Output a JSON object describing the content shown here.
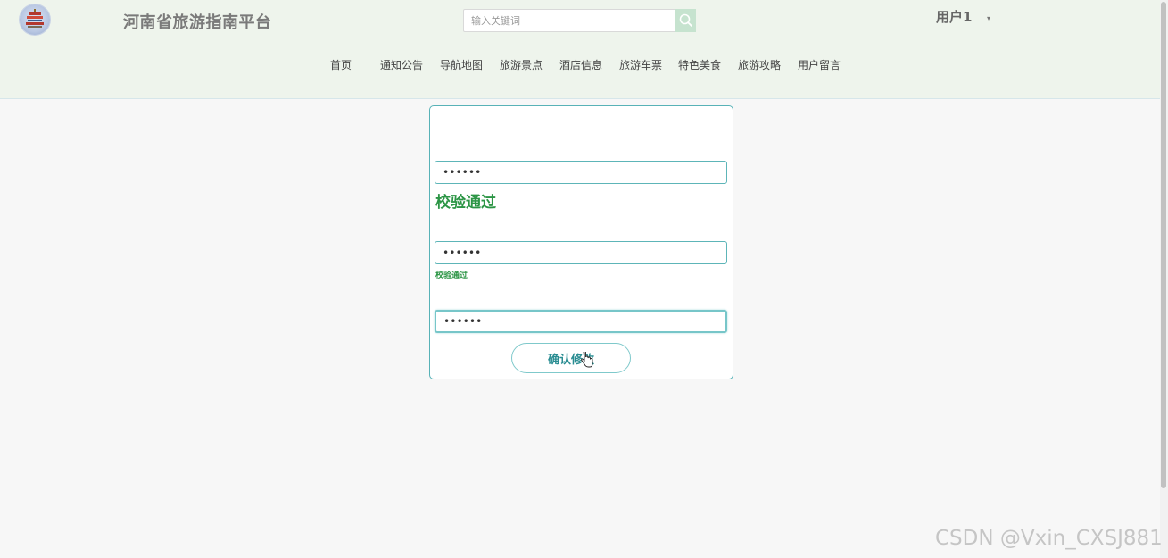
{
  "header": {
    "site_title": "河南省旅游指南平台",
    "search": {
      "placeholder": "输入关键词",
      "value": ""
    },
    "user_menu": {
      "label": "用户1",
      "caret": "▾"
    },
    "nav": [
      "首页",
      "通知公告",
      "导航地图",
      "旅游景点",
      "酒店信息",
      "旅游车票",
      "特色美食",
      "旅游攻略",
      "用户留言"
    ]
  },
  "form": {
    "old_password": "••••••",
    "old_password_status": "校验通过",
    "new_password": "••••••",
    "new_password_status": "校验通过",
    "confirm_password": "••••••",
    "submit_label": "确认修改"
  },
  "watermark": "CSDN @Vxin_CXSJ881",
  "colors": {
    "header_bg": "#eef4ec",
    "accent": "#58b2b7",
    "success": "#2c9545",
    "search_button": "#c6e3cf"
  },
  "icons": {
    "search": "search-icon",
    "caret": "caret-down-icon",
    "cursor": "hand-cursor-icon"
  }
}
